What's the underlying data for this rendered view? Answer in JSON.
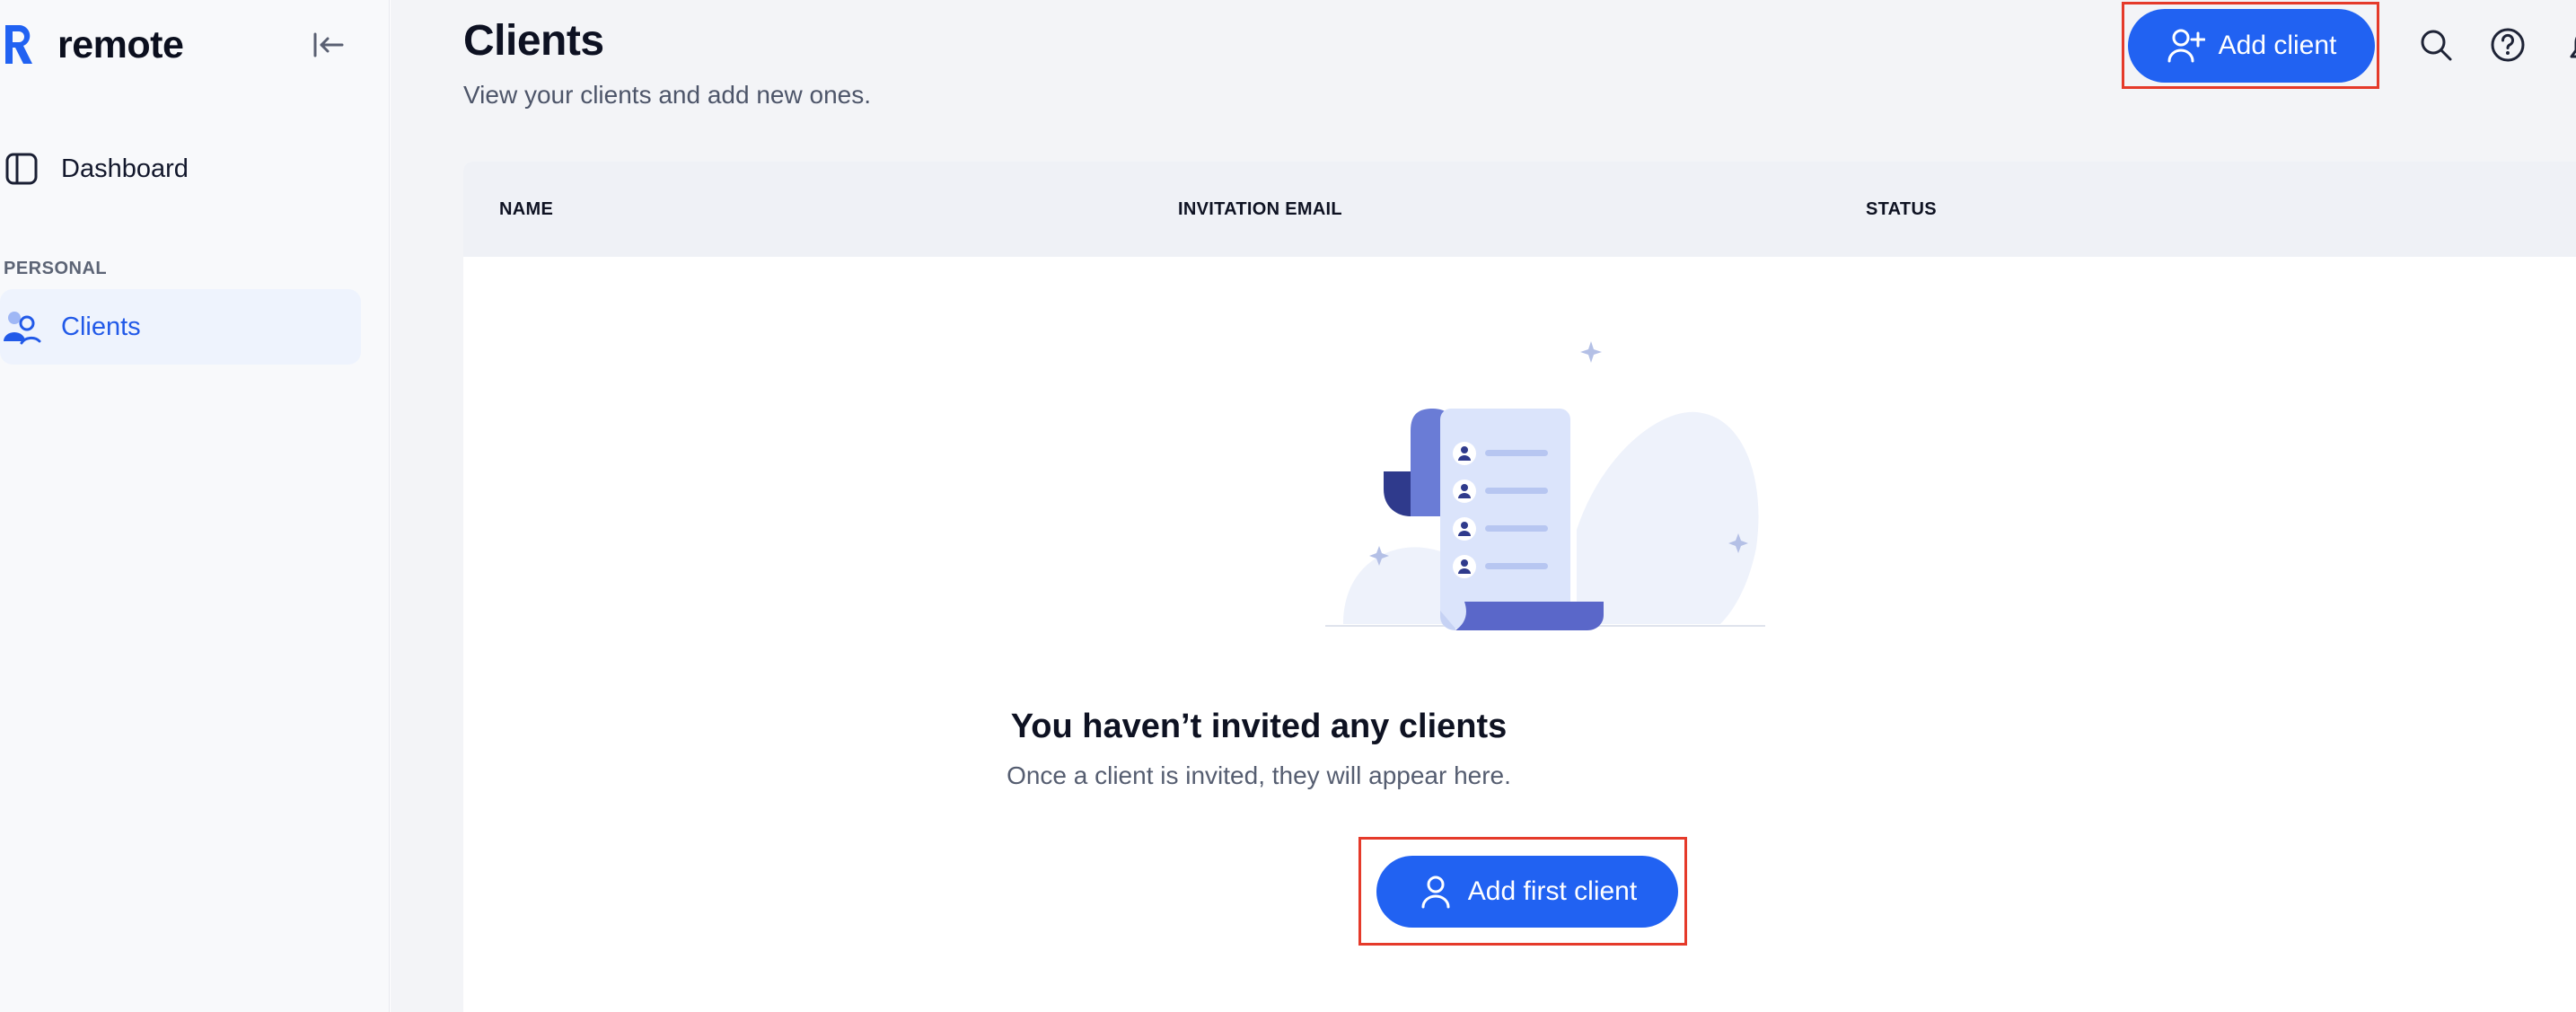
{
  "brand": {
    "name": "remote",
    "accent": "#2162f2"
  },
  "sidebar": {
    "collapse_icon": "collapse-left-icon",
    "items": [
      {
        "label": "Dashboard",
        "icon": "sidebar-panel-icon",
        "active": false
      },
      {
        "label": "Clients",
        "icon": "clients-icon",
        "active": true
      }
    ],
    "section_label": "PERSONAL"
  },
  "header": {
    "title": "Clients",
    "subtitle": "View your clients and add new ones.",
    "add_client_label": "Add client",
    "icons": [
      "search-icon",
      "help-icon",
      "bell-icon"
    ]
  },
  "table": {
    "columns": [
      "NAME",
      "INVITATION EMAIL",
      "STATUS"
    ],
    "rows": []
  },
  "empty_state": {
    "title": "You haven’t invited any clients",
    "subtitle": "Once a client is invited, they will appear here.",
    "button_label": "Add first client"
  },
  "colors": {
    "primary_button": "#2162f2",
    "highlight_border": "#e53a2a",
    "active_nav_bg": "#eef3fd"
  }
}
